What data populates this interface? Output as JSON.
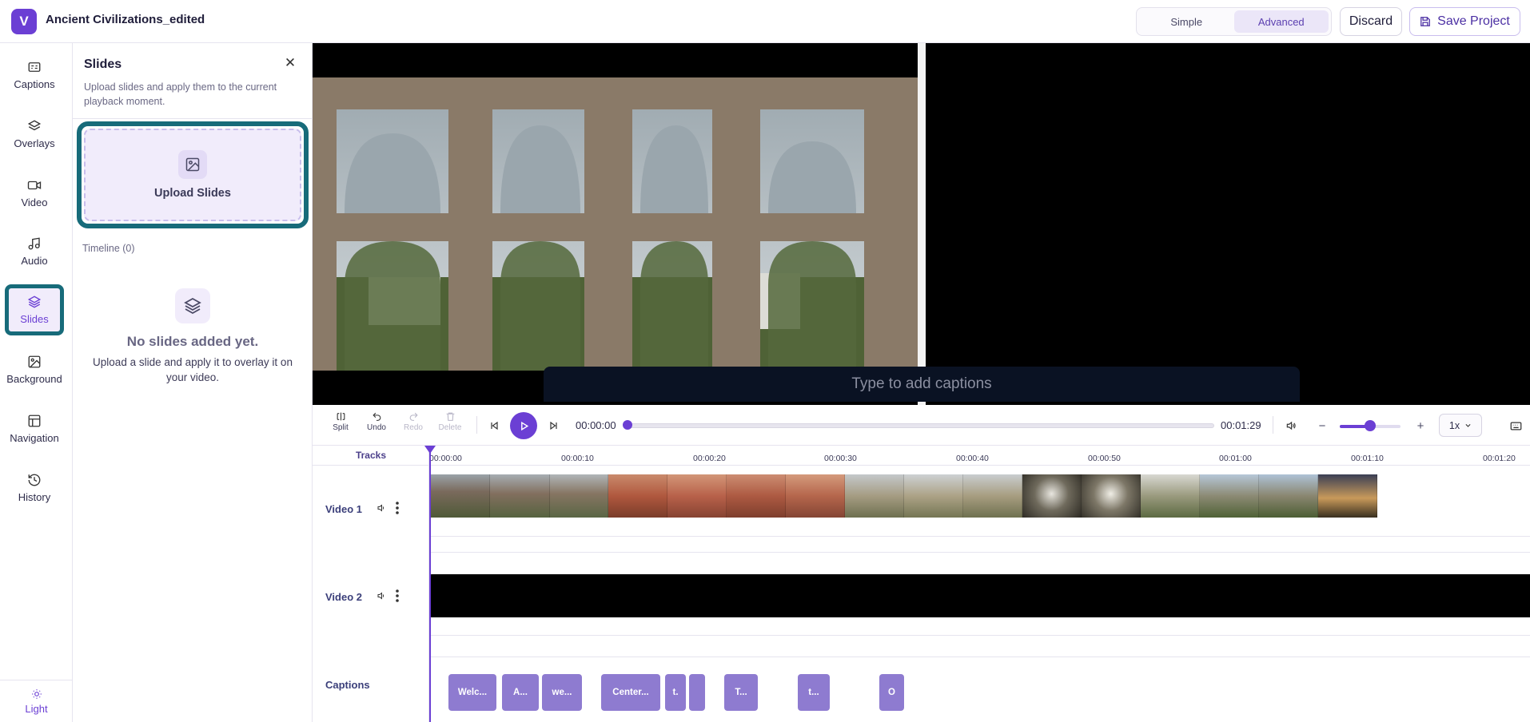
{
  "header": {
    "logo_letter": "V",
    "project_title": "Ancient Civilizations_edited",
    "mode_simple": "Simple",
    "mode_advanced": "Advanced",
    "discard_label": "Discard",
    "save_label": "Save Project"
  },
  "rail": {
    "items": [
      {
        "label": "Captions"
      },
      {
        "label": "Overlays"
      },
      {
        "label": "Video"
      },
      {
        "label": "Audio"
      },
      {
        "label": "Slides"
      },
      {
        "label": "Background"
      },
      {
        "label": "Navigation"
      },
      {
        "label": "History"
      }
    ],
    "theme_label": "Light"
  },
  "panel": {
    "title": "Slides",
    "description": "Upload slides and apply them to the current playback moment.",
    "upload_label": "Upload Slides",
    "timeline_count": "Timeline (0)",
    "empty_title": "No slides added yet.",
    "empty_desc": "Upload a slide and apply it to overlay it on your video."
  },
  "preview": {
    "caption_placeholder": "Type to add captions"
  },
  "controls": {
    "split_label": "Split",
    "undo_label": "Undo",
    "redo_label": "Redo",
    "delete_label": "Delete",
    "current_time": "00:00:00",
    "total_time": "00:01:29",
    "playback_progress": 0.0,
    "zoom_level": 0.5,
    "speed": "1x"
  },
  "timeline": {
    "tracks_header": "Tracks",
    "ruler_ticks": [
      "00:00:00",
      "00:00:10",
      "00:00:20",
      "00:00:30",
      "00:00:40",
      "00:00:50",
      "00:01:00",
      "00:01:10",
      "00:01:20"
    ],
    "tracks": [
      {
        "label": "Video 1"
      },
      {
        "label": "Video 2"
      },
      {
        "label": "Captions"
      }
    ],
    "caption_clips": [
      "Welc...",
      "A...",
      "we...",
      "Center...",
      "t.",
      "",
      "T...",
      "t...",
      "O"
    ]
  }
}
